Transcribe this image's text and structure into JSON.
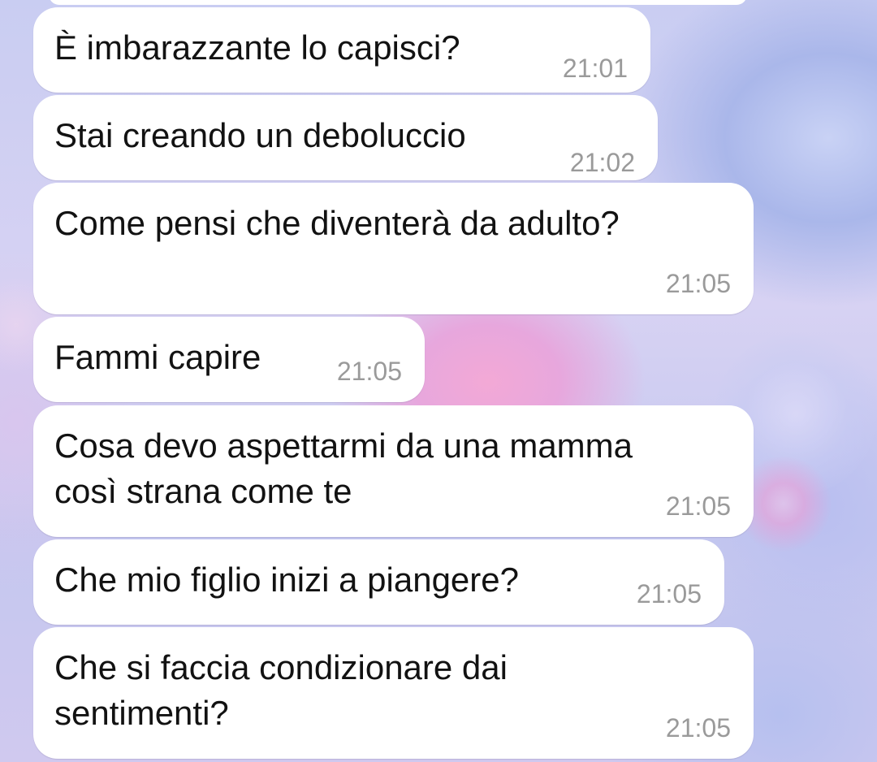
{
  "chat": {
    "messages": [
      {
        "text": "È imbarazzante lo capisci?",
        "time": "21:01"
      },
      {
        "text": "Stai creando un deboluccio",
        "time": "21:02"
      },
      {
        "text": "Come pensi che diventerà da adulto?",
        "time": "21:05"
      },
      {
        "text": "Fammi capire",
        "time": "21:05"
      },
      {
        "text": "Cosa devo aspettarmi da una mamma\ncosì strana come te",
        "time": "21:05"
      },
      {
        "text": "Che mio figlio inizi a piangere?",
        "time": "21:05"
      },
      {
        "text": "Che si faccia condizionare dai\nsentimenti?",
        "time": "21:05"
      }
    ]
  },
  "colors": {
    "bubble_background": "#ffffff",
    "message_text": "#121212",
    "timestamp_text": "#9a9a9a",
    "wallpaper_base": "#c9cdf2",
    "wallpaper_accent_pink": "#f3a9d6"
  }
}
